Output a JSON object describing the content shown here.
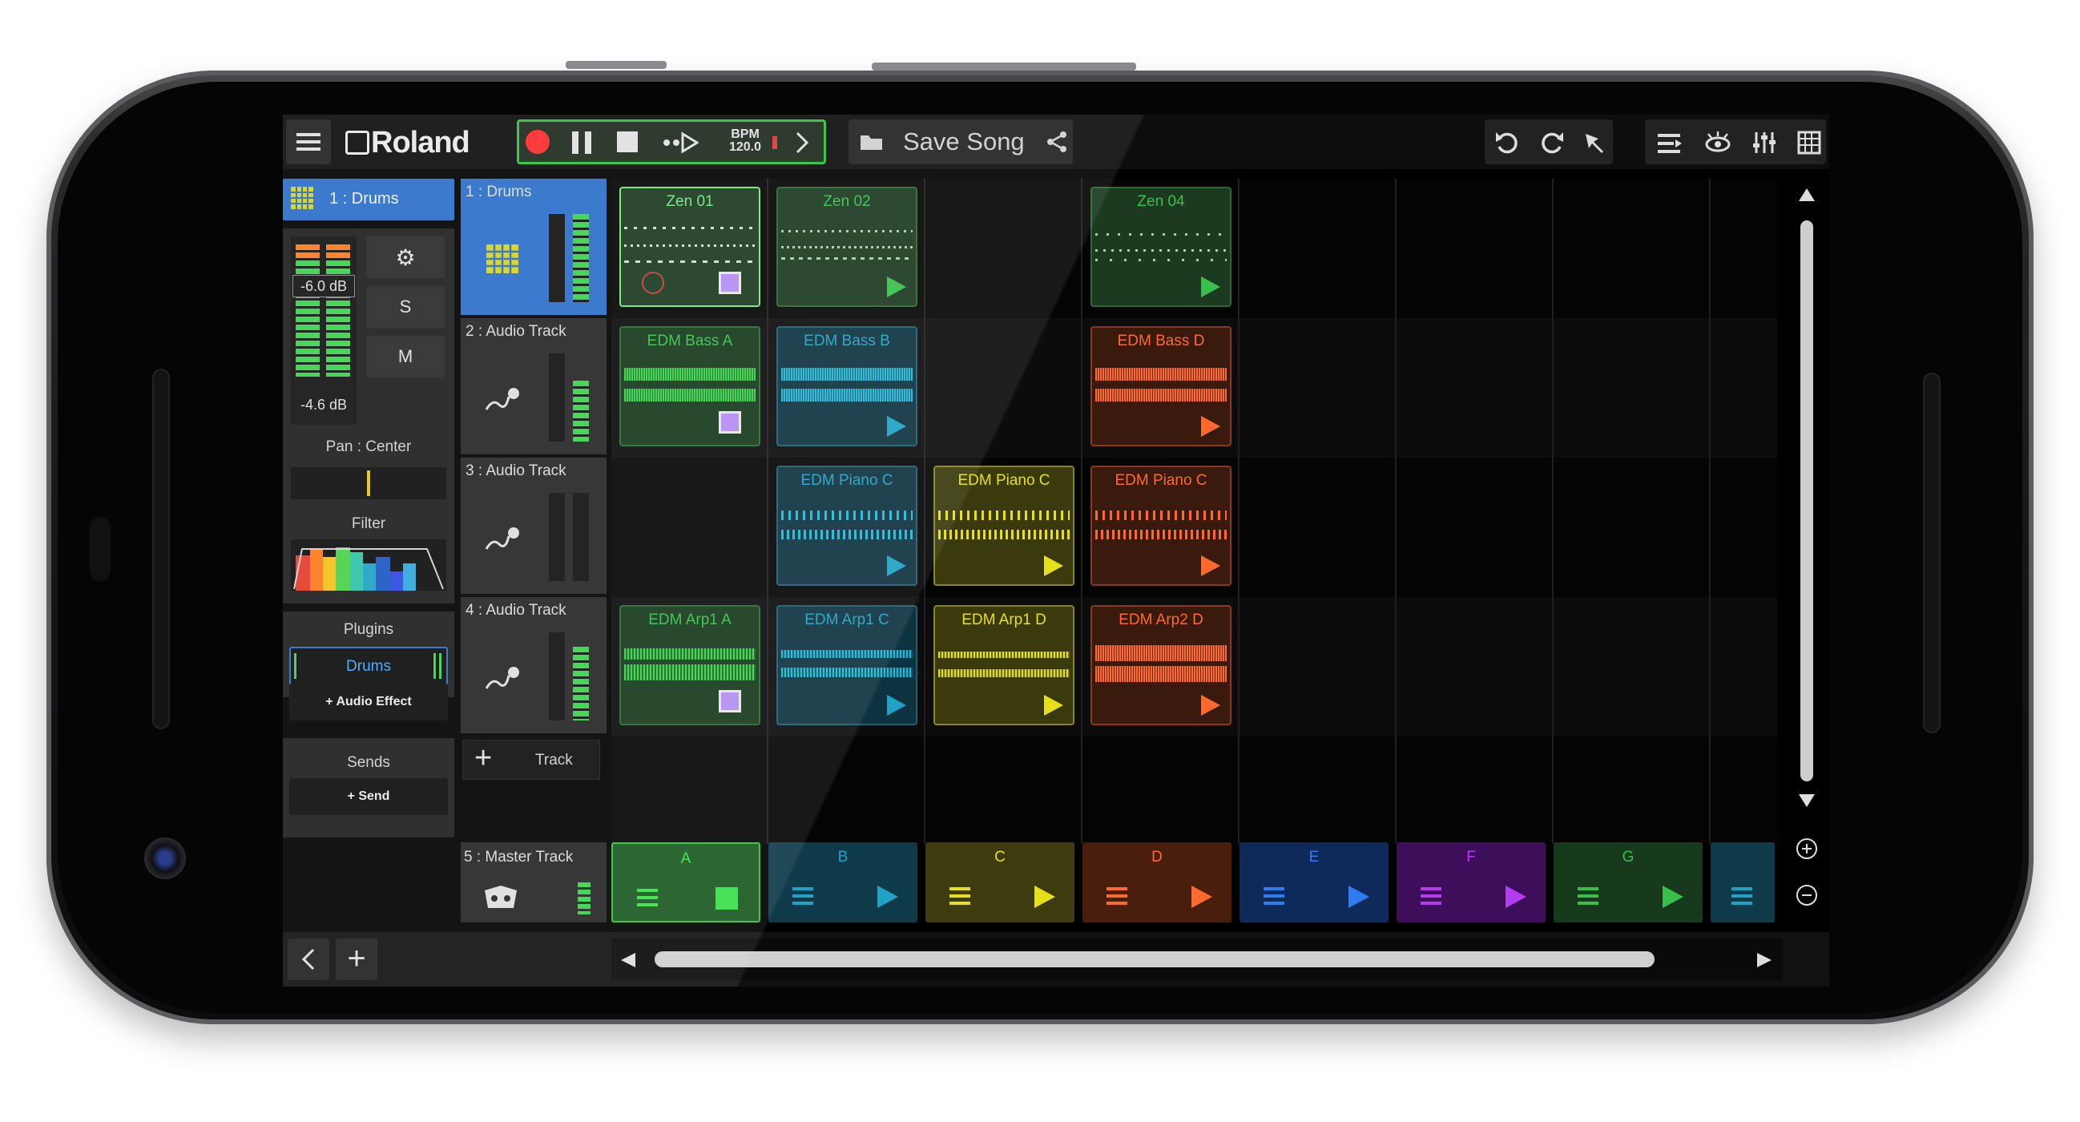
{
  "topbar": {
    "brand": "Roland",
    "bpm_label": "BPM",
    "bpm_value": "120.0",
    "song_title": "Save Song"
  },
  "left_panel": {
    "track_title": "1 : Drums",
    "level_db_top": "-6.0 dB",
    "level_db_bottom": "-4.6 dB",
    "solo_label": "S",
    "mute_label": "M",
    "pan_label": "Pan : Center",
    "filter_label": "Filter",
    "plugins_label": "Plugins",
    "plugin_instrument": "Drums",
    "add_audio_effect": "+ Audio Effect",
    "sends_label": "Sends",
    "add_send": "+ Send"
  },
  "tracks": [
    {
      "name": "1 : Drums"
    },
    {
      "name": "2 : Audio Track"
    },
    {
      "name": "3 : Audio Track"
    },
    {
      "name": "4 : Audio Track"
    }
  ],
  "add_track_label": "Track",
  "master_track": "5 : Master Track",
  "clips": {
    "r1c1": "Zen 01",
    "r1c2": "Zen 02",
    "r1c4": "Zen 04",
    "r2c1": "EDM Bass A",
    "r2c2": "EDM Bass B",
    "r2c4": "EDM Bass D",
    "r3c2": "EDM Piano C",
    "r3c3": "EDM Piano C",
    "r3c4": "EDM Piano C",
    "r4c1": "EDM Arp1 A",
    "r4c2": "EDM Arp1 C",
    "r4c3": "EDM Arp1 D",
    "r4c4": "EDM Arp2 D"
  },
  "scenes": [
    "A",
    "B",
    "C",
    "D",
    "E",
    "F",
    "G"
  ],
  "colors": {
    "green": "#2fc43c",
    "cyan": "#1fa3c4",
    "yellow": "#d6d21a",
    "orange": "#ff5a1a",
    "blue": "#1b57c4",
    "purple": "#9b2bd1",
    "accent_selected": "#2c6fc9"
  }
}
